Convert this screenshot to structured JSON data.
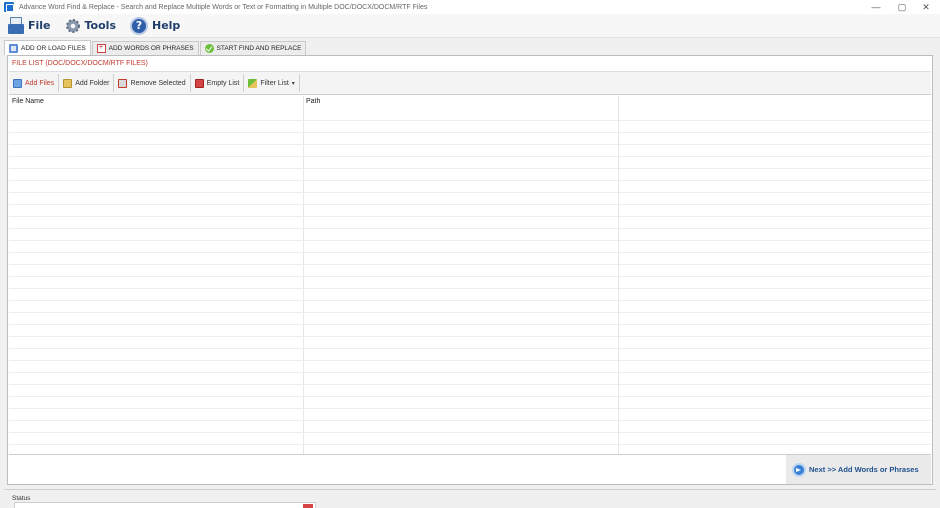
{
  "window": {
    "title": "Advance Word Find & Replace - Search and Replace Multiple Words or Text  or Formatting in Multiple DOC/DOCX/DOCM/RTF Files",
    "controls": {
      "minimize": "—",
      "maximize": "▢",
      "close": "✕"
    }
  },
  "menu": [
    {
      "label": "File",
      "icon": "file-icon"
    },
    {
      "label": "Tools",
      "icon": "gear-icon"
    },
    {
      "label": "Help",
      "icon": "help-icon"
    }
  ],
  "tabs": [
    {
      "label": "ADD OR LOAD FILES",
      "active": true
    },
    {
      "label": "ADD WORDS OR PHRASES",
      "active": false
    },
    {
      "label": "START FIND AND REPLACE",
      "active": false
    }
  ],
  "panel": {
    "title": "FILE LIST (DOC/DOCX/DOCM/RTF FILES)"
  },
  "toolbar": {
    "add_files": "Add Files",
    "add_folder": "Add Folder",
    "remove_selected": "Remove Selected",
    "empty_list": "Empty List",
    "filter_list": "Filter List",
    "filter_caret": "▾"
  },
  "table": {
    "columns": [
      "File Name",
      "Path",
      ""
    ],
    "rows": []
  },
  "next_button": {
    "label": "Next >> Add Words or Phrases"
  },
  "status": {
    "label": "Status"
  },
  "colors": {
    "accent_red": "#c0392b",
    "brand_blue": "#1f4f8f"
  }
}
